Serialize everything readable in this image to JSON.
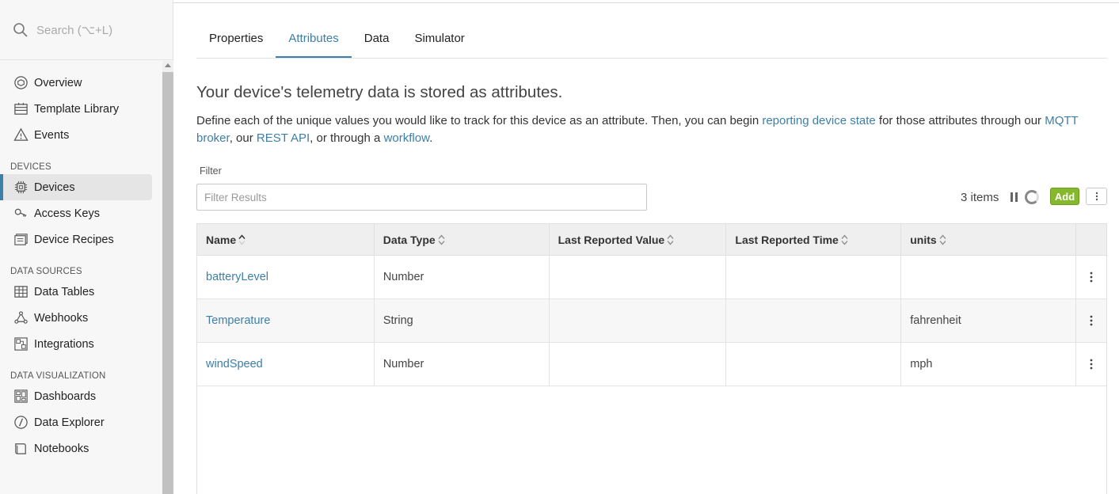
{
  "sidebar": {
    "search_placeholder": "Search (⌥+L)",
    "items": [
      {
        "label": "Overview",
        "icon": "overview-icon"
      },
      {
        "label": "Template Library",
        "icon": "template-library-icon"
      },
      {
        "label": "Events",
        "icon": "warning-icon"
      }
    ],
    "sections": [
      {
        "title": "DEVICES",
        "items": [
          {
            "label": "Devices",
            "icon": "chip-icon",
            "active": true
          },
          {
            "label": "Access Keys",
            "icon": "key-icon"
          },
          {
            "label": "Device Recipes",
            "icon": "recipe-icon"
          }
        ]
      },
      {
        "title": "DATA SOURCES",
        "items": [
          {
            "label": "Data Tables",
            "icon": "table-icon"
          },
          {
            "label": "Webhooks",
            "icon": "webhook-icon"
          },
          {
            "label": "Integrations",
            "icon": "integrations-icon"
          }
        ]
      },
      {
        "title": "DATA VISUALIZATION",
        "items": [
          {
            "label": "Dashboards",
            "icon": "dashboard-icon"
          },
          {
            "label": "Data Explorer",
            "icon": "compass-icon"
          },
          {
            "label": "Notebooks",
            "icon": "notebook-icon"
          }
        ]
      }
    ]
  },
  "tabs": [
    "Properties",
    "Attributes",
    "Data",
    "Simulator"
  ],
  "active_tab": "Attributes",
  "main": {
    "heading": "Your device's telemetry data is stored as attributes.",
    "desc_1": "Define each of the unique values you would like to track for this device as an attribute. Then, you can begin ",
    "desc_link_1": "reporting device state",
    "desc_2": " for those attributes through our ",
    "desc_link_2": "MQTT broker",
    "desc_3": ", our ",
    "desc_link_3": "REST API",
    "desc_4": ", or through a ",
    "desc_link_4": "workflow",
    "desc_5": ".",
    "filter_label": "Filter",
    "filter_placeholder": "Filter Results",
    "filter_value": "",
    "items_count": "3 items",
    "add_label": "Add"
  },
  "table": {
    "columns": [
      "Name",
      "Data Type",
      "Last Reported Value",
      "Last Reported Time",
      "units"
    ],
    "rows": [
      {
        "name": "batteryLevel",
        "type": "Number",
        "value": "",
        "time": "",
        "units": ""
      },
      {
        "name": "Temperature",
        "type": "String",
        "value": "",
        "time": "",
        "units": "fahrenheit"
      },
      {
        "name": "windSpeed",
        "type": "Number",
        "value": "",
        "time": "",
        "units": "mph"
      }
    ]
  },
  "colors": {
    "accent": "#3d7fa8",
    "add_button": "#85b82c"
  }
}
